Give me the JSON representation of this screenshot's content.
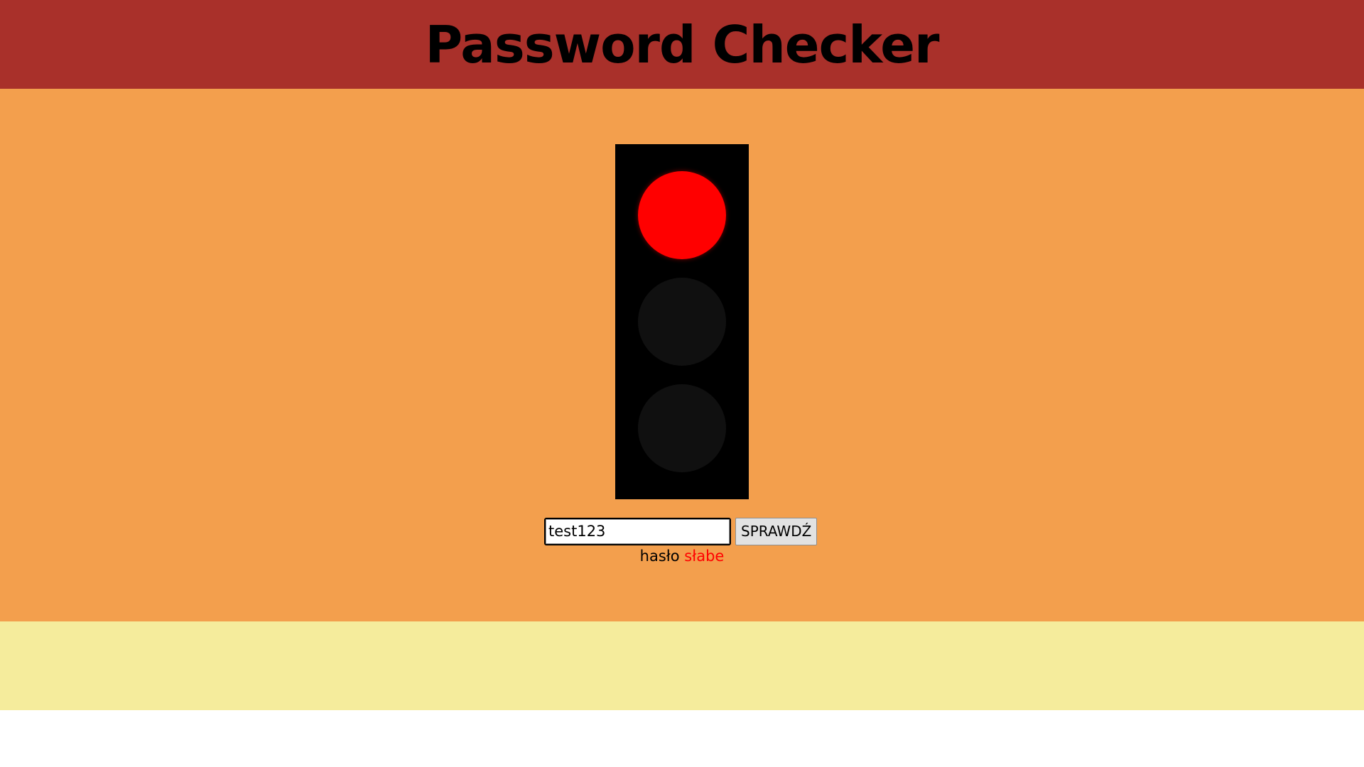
{
  "header": {
    "title": "Password Checker"
  },
  "traffic_light": {
    "active_lamp": "red",
    "lamps": [
      "red",
      "yellow",
      "green"
    ]
  },
  "form": {
    "password_value": "test123",
    "check_button_label": "SPRAWDŹ"
  },
  "result": {
    "label": "hasło",
    "strength": "słabe",
    "strength_color": "#ff0000"
  },
  "colors": {
    "header_bg": "#a9302a",
    "main_bg": "#f39f4d",
    "footer_bg": "#f5ec9c",
    "lamp_on_red": "#ff0000",
    "lamp_off": "#101010"
  }
}
